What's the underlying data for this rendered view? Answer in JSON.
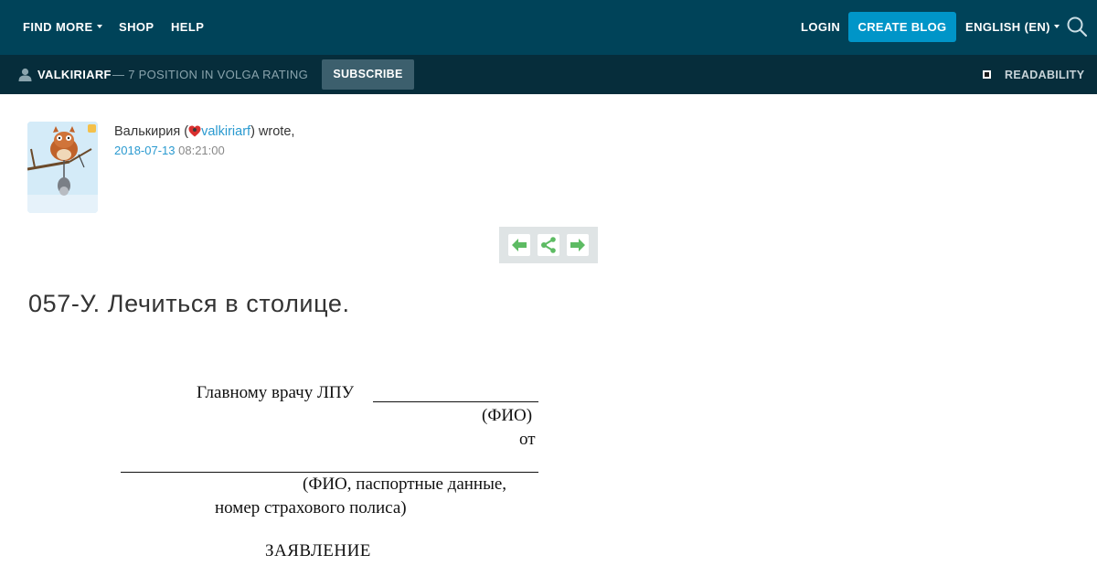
{
  "topbar": {
    "find_more": "FIND MORE",
    "shop": "SHOP",
    "help": "HELP",
    "login": "LOGIN",
    "create_blog": "CREATE BLOG",
    "language": "ENGLISH (EN)",
    "background_color": "#004359",
    "accent_color": "#0095c8"
  },
  "subbar": {
    "username": "VALKIRIARF",
    "rating": "— 7 POSITION IN VOLGA RATING",
    "subscribe": "SUBSCRIBE",
    "readability": "READABILITY",
    "background_color": "#062d3b"
  },
  "post": {
    "author_name": "Валькирия (",
    "author_handle": "valkiriarf",
    "author_suffix": ") wrote,",
    "date": "2018-07-13",
    "time": "08:21:00",
    "title": "057-У. Лечиться в столице.",
    "link_color": "#2a9ad0"
  },
  "document": {
    "line_head": "Главному врачу ЛПУ",
    "line_fio": "(ФИО)",
    "line_ot": "от",
    "line_passport": "(ФИО, паспортные данные,",
    "line_policy": "номер страхового полиса)",
    "line_heading": "ЗАЯВЛЕНИЕ"
  },
  "icons": {
    "search": "search-icon",
    "user": "user-icon",
    "prev": "arrow-left-icon",
    "share": "share-icon",
    "next": "arrow-right-icon",
    "heart": "heart-user-icon"
  }
}
